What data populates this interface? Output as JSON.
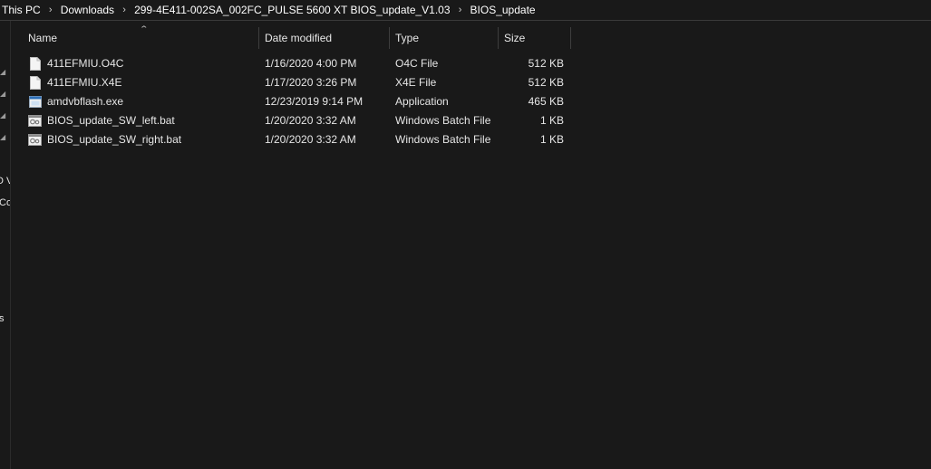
{
  "breadcrumb": {
    "items": [
      "This PC",
      "Downloads",
      "299-4E411-002SA_002FC_PULSE 5600 XT BIOS_update_V1.03",
      "BIOS_update"
    ]
  },
  "nav_pane": {
    "clipped_labels": [
      "D V",
      "Co",
      "s"
    ]
  },
  "columns": {
    "name": "Name",
    "date_modified": "Date modified",
    "type": "Type",
    "size": "Size"
  },
  "files": [
    {
      "name": "411EFMIU.O4C",
      "date": "1/16/2020 4:00 PM",
      "type": "O4C File",
      "size": "512 KB",
      "icon": "document-icon"
    },
    {
      "name": "411EFMIU.X4E",
      "date": "1/17/2020 3:26 PM",
      "type": "X4E File",
      "size": "512 KB",
      "icon": "document-icon"
    },
    {
      "name": "amdvbflash.exe",
      "date": "12/23/2019 9:14 PM",
      "type": "Application",
      "size": "465 KB",
      "icon": "application-icon"
    },
    {
      "name": "BIOS_update_SW_left.bat",
      "date": "1/20/2020 3:32 AM",
      "type": "Windows Batch File",
      "size": "1 KB",
      "icon": "batch-file-icon"
    },
    {
      "name": "BIOS_update_SW_right.bat",
      "date": "1/20/2020 3:32 AM",
      "type": "Windows Batch File",
      "size": "1 KB",
      "icon": "batch-file-icon"
    }
  ]
}
